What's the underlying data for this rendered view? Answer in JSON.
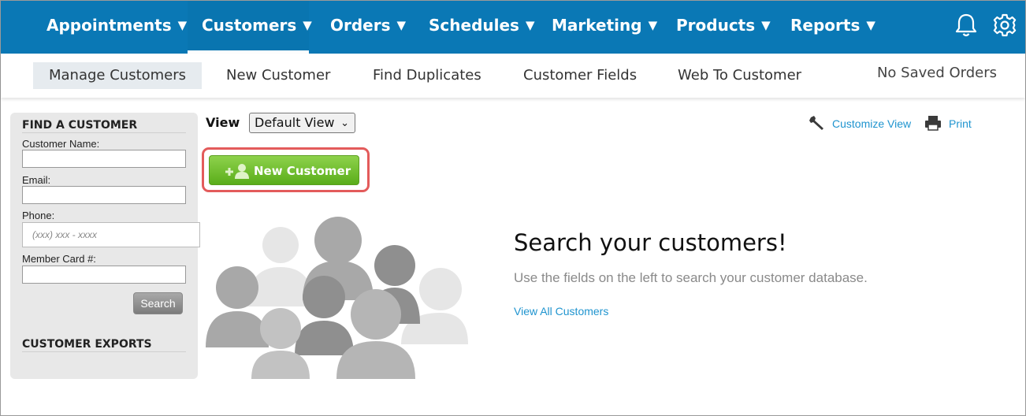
{
  "topnav": {
    "items": [
      {
        "label": "Appointments",
        "caret": "▼"
      },
      {
        "label": "Customers",
        "caret": "▼"
      },
      {
        "label": "Orders",
        "caret": "▼"
      },
      {
        "label": "Schedules",
        "caret": "▼"
      },
      {
        "label": "Marketing",
        "caret": "▼"
      },
      {
        "label": "Products",
        "caret": "▼"
      },
      {
        "label": "Reports",
        "caret": "▼"
      }
    ],
    "active": "Customers",
    "icons": [
      "bell-icon",
      "gear-icon"
    ],
    "color": "#0a78b5"
  },
  "subnav": {
    "items": [
      "Manage Customers",
      "New Customer",
      "Find Duplicates",
      "Customer Fields",
      "Web To Customer"
    ],
    "active": "Manage Customers",
    "saved_orders": "No Saved Orders"
  },
  "find_panel": {
    "heading": "FIND A CUSTOMER",
    "fields": {
      "name_label": "Customer Name:",
      "email_label": "Email:",
      "phone_label": "Phone:",
      "phone_placeholder": "(xxx) xxx - xxxx",
      "member_label": "Member Card #:"
    },
    "search_button": "Search",
    "exports_heading": "CUSTOMER EXPORTS"
  },
  "view": {
    "label": "View",
    "selected": "Default View",
    "chevron": "⌄"
  },
  "tools": {
    "customize": "Customize View",
    "print": "Print",
    "customize_icon": "wrench-icon",
    "print_icon": "printer-icon"
  },
  "new_customer_button": {
    "label": "New Customer",
    "icon": "add-person-icon",
    "highlight_color": "#e35b5b",
    "color": "#6bbd2b"
  },
  "empty_state": {
    "title": "Search your customers!",
    "subtitle": "Use the fields on the left to search your customer database.",
    "link": "View All Customers"
  }
}
